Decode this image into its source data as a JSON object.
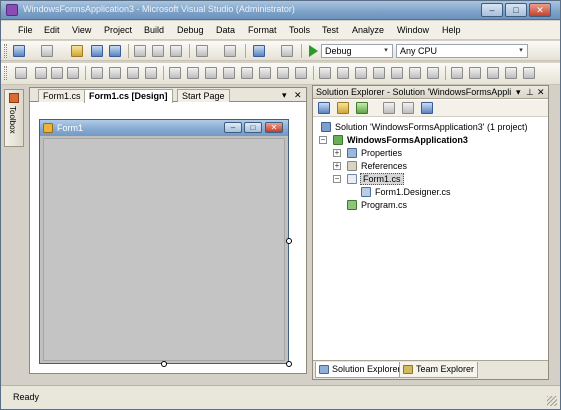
{
  "window": {
    "title": "WindowsFormsApplication3 - Microsoft Visual Studio (Administrator)",
    "minimize_glyph": "–",
    "maximize_glyph": "□",
    "close_glyph": "✕"
  },
  "menu": [
    "File",
    "Edit",
    "View",
    "Project",
    "Build",
    "Debug",
    "Data",
    "Format",
    "Tools",
    "Test",
    "Analyze",
    "Window",
    "Help"
  ],
  "toolbar": {
    "configuration": "Debug",
    "platform": "Any CPU",
    "dropdown_glyph": "▾"
  },
  "toolbox": {
    "label": "Toolbox"
  },
  "document_tabs": [
    "Form1.cs",
    "Form1.cs [Design]",
    "Start Page"
  ],
  "document_controls": {
    "menu_glyph": "▾",
    "close_glyph": "✕"
  },
  "form": {
    "title": "Form1",
    "minimize_glyph": "–",
    "maximize_glyph": "□",
    "close_glyph": "✕"
  },
  "solution_explorer": {
    "title": "Solution Explorer - Solution 'WindowsFormsAppli...",
    "pin_glyph": "▾",
    "autohide_glyph": "⊥",
    "close_glyph": "✕",
    "expanded_glyph": "−",
    "collapsed_glyph": "+",
    "tree": {
      "solution": "Solution 'WindowsFormsApplication3' (1 project)",
      "project": "WindowsFormsApplication3",
      "properties": "Properties",
      "references": "References",
      "form1": "Form1.cs",
      "form1_designer": "Form1.Designer.cs",
      "program": "Program.cs"
    },
    "bottom_tabs": [
      "Solution Explorer",
      "Team Explorer"
    ]
  },
  "status": {
    "text": "Ready"
  }
}
